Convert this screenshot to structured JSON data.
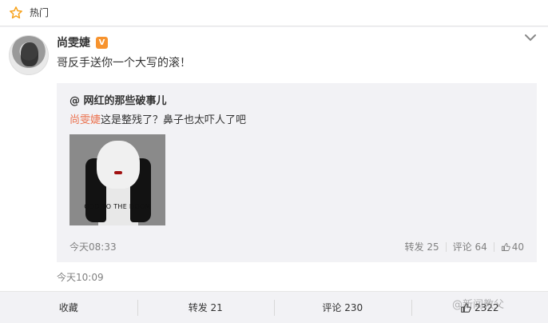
{
  "hot": {
    "label": "热门"
  },
  "post": {
    "username": "尚雯婕",
    "badge": "V",
    "text": "哥反手送你一个大写的滚！",
    "time": "今天10:09"
  },
  "quote": {
    "author": "@ 网红的那些破事儿",
    "mention": "尚雯婕",
    "text_rest": "这是整残了？鼻子也太吓人了吧",
    "image_caption": "ODD TO THE DOOM",
    "time": "今天08:33",
    "repost": "转发 25",
    "comment": "评论 64",
    "like": "40"
  },
  "actions": {
    "favorite": "收藏",
    "repost": "转发 21",
    "comment": "评论 230",
    "like": "2322"
  },
  "watermark": "@新闻教父",
  "colors": {
    "accent": "#eb7350",
    "badge": "#f7932e",
    "meta": "#808080"
  },
  "icons": [
    "star-outline-icon",
    "chevron-down-icon",
    "thumbs-up-icon"
  ]
}
